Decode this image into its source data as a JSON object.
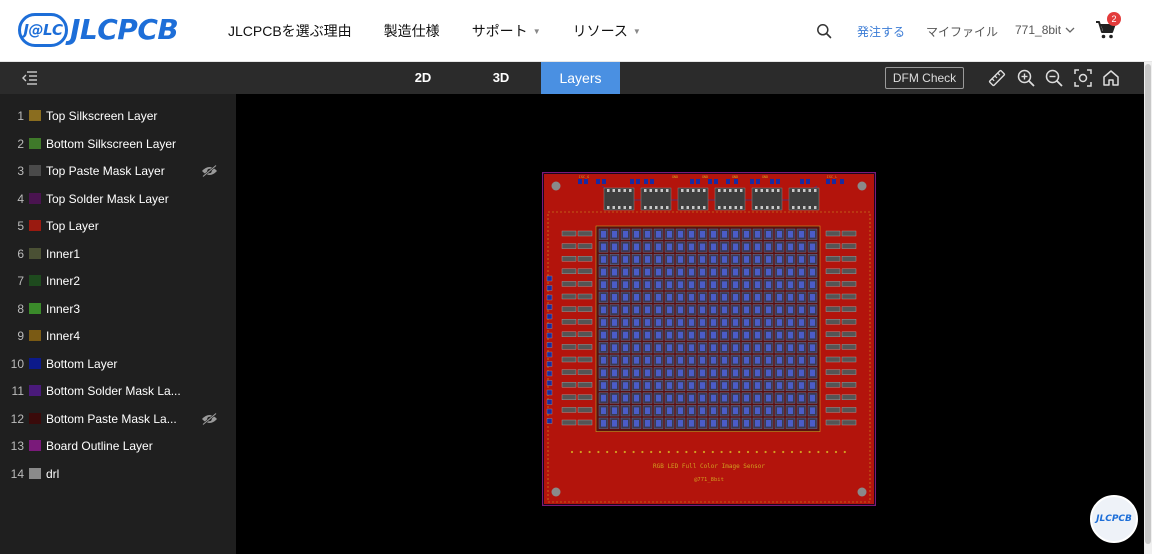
{
  "brand": {
    "badge_text": "J@LC",
    "name": "JLCPCB",
    "color": "#1d6ed8"
  },
  "nav": {
    "items": [
      {
        "label": "JLCPCBを選ぶ理由",
        "has_dropdown": false
      },
      {
        "label": "製造仕様",
        "has_dropdown": false
      },
      {
        "label": "サポート",
        "has_dropdown": true
      },
      {
        "label": "リソース",
        "has_dropdown": true
      }
    ],
    "search_icon": "search-icon",
    "order_label": "発注する",
    "myfile_label": "マイファイル",
    "user_label": "771_8bit",
    "cart_count": "2"
  },
  "toolbar": {
    "tabs": [
      {
        "label": "2D",
        "active": false
      },
      {
        "label": "3D",
        "active": false
      },
      {
        "label": "Layers",
        "active": true
      }
    ],
    "dfm_label": "DFM Check",
    "tools": [
      "ruler-icon",
      "zoom-in-icon",
      "zoom-out-icon",
      "fit-view-icon",
      "home-icon"
    ],
    "active_color": "#4a90e2"
  },
  "layers": [
    {
      "num": "1",
      "name": "Top Silkscreen Layer",
      "color": "#8a6d1f",
      "hidden": false
    },
    {
      "num": "2",
      "name": "Bottom Silkscreen Layer",
      "color": "#3f7a2a",
      "hidden": false
    },
    {
      "num": "3",
      "name": "Top Paste Mask Layer",
      "color": "#4a4a4a",
      "hidden": true
    },
    {
      "num": "4",
      "name": "Top Solder Mask Layer",
      "color": "#4a1450",
      "hidden": false
    },
    {
      "num": "5",
      "name": "Top Layer",
      "color": "#9a1a10",
      "hidden": false
    },
    {
      "num": "6",
      "name": "Inner1",
      "color": "#4a5034",
      "hidden": false
    },
    {
      "num": "7",
      "name": "Inner2",
      "color": "#1e4a1e",
      "hidden": false
    },
    {
      "num": "8",
      "name": "Inner3",
      "color": "#3a8a2a",
      "hidden": false
    },
    {
      "num": "9",
      "name": "Inner4",
      "color": "#7a5a14",
      "hidden": false
    },
    {
      "num": "10",
      "name": "Bottom Layer",
      "color": "#0c1a8a",
      "hidden": false
    },
    {
      "num": "11",
      "name": "Bottom Solder Mask La...",
      "color": "#4a1a7a",
      "hidden": false
    },
    {
      "num": "12",
      "name": "Bottom Paste Mask La...",
      "color": "#3a0a0a",
      "hidden": true
    },
    {
      "num": "13",
      "name": "Board Outline Layer",
      "color": "#7a1a7a",
      "hidden": false
    },
    {
      "num": "14",
      "name": "drl",
      "color": "#8a8a8a",
      "hidden": false
    }
  ],
  "board": {
    "silk_line1": "RGB LED Full Color Image Sensor",
    "silk_line2": "@771_8bit",
    "conn_labels": [
      "ISC_G",
      "ISC_L",
      "GND",
      "GND",
      "GND",
      "GND"
    ],
    "board_color": "#b3140c",
    "silk_color": "#d2a020"
  },
  "float_badge": "JLCPCB"
}
